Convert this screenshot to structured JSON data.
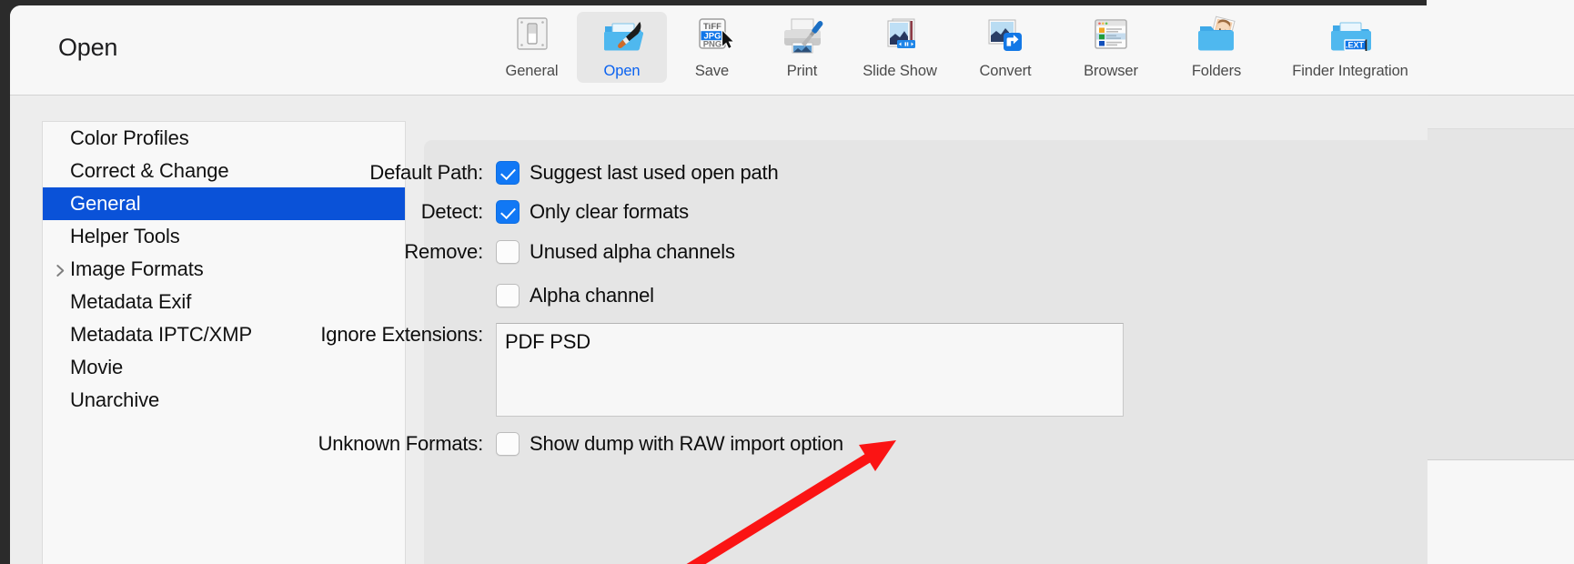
{
  "window": {
    "title": "Open"
  },
  "toolbar": {
    "items": [
      {
        "label": "General",
        "icon": "toggle-switch-icon",
        "active": false
      },
      {
        "label": "Open",
        "icon": "folder-paintbrush-icon",
        "active": true
      },
      {
        "label": "Save",
        "icon": "format-list-cursor-icon",
        "active": false
      },
      {
        "label": "Print",
        "icon": "printer-screwdriver-icon",
        "active": false
      },
      {
        "label": "Slide Show",
        "icon": "photo-stack-play-icon",
        "active": false
      },
      {
        "label": "Convert",
        "icon": "photo-arrow-icon",
        "active": false
      },
      {
        "label": "Browser",
        "icon": "window-list-icon",
        "active": false
      },
      {
        "label": "Folders",
        "icon": "folder-photo-icon",
        "active": false
      },
      {
        "label": "Finder Integration",
        "icon": "folder-ext-icon",
        "active": false
      }
    ],
    "save_icon_labels": [
      "TiFF",
      "JPG",
      "PNG"
    ],
    "ext_badge": ".EXT"
  },
  "sidebar": {
    "items": [
      {
        "label": "Color Profiles",
        "selected": false,
        "expandable": false
      },
      {
        "label": "Correct & Change",
        "selected": false,
        "expandable": false
      },
      {
        "label": "General",
        "selected": true,
        "expandable": false
      },
      {
        "label": "Helper Tools",
        "selected": false,
        "expandable": false
      },
      {
        "label": "Image Formats",
        "selected": false,
        "expandable": true
      },
      {
        "label": "Metadata Exif",
        "selected": false,
        "expandable": false
      },
      {
        "label": "Metadata IPTC/XMP",
        "selected": false,
        "expandable": false
      },
      {
        "label": "Movie",
        "selected": false,
        "expandable": false
      },
      {
        "label": "Unarchive",
        "selected": false,
        "expandable": false
      }
    ]
  },
  "settings": {
    "default_path": {
      "label": "Default Path:",
      "checkbox_label": "Suggest last used open path",
      "checked": true
    },
    "detect": {
      "label": "Detect:",
      "checkbox_label": "Only clear formats",
      "checked": true
    },
    "remove": {
      "label": "Remove:",
      "checkbox_label_1": "Unused alpha channels",
      "checked_1": false,
      "checkbox_label_2": "Alpha channel",
      "checked_2": false
    },
    "ignore_extensions": {
      "label": "Ignore Extensions:",
      "value": "PDF PSD",
      "placeholder": ""
    },
    "unknown_formats": {
      "label": "Unknown Formats:",
      "checkbox_label": "Show dump with RAW import option",
      "checked": false
    }
  },
  "annotation": {
    "arrow_color": "#fb1414",
    "points_to": "unknown-formats-checkbox"
  },
  "colors": {
    "accent_selection": "#0a52d8",
    "accent_checkbox": "#1178f5",
    "accent_active_label": "#0a62f0",
    "toolbar_bg": "#f7f7f7",
    "window_bg": "#ededed",
    "panel_bg": "#e5e5e5",
    "sidebar_bg": "#f8f8f8"
  }
}
